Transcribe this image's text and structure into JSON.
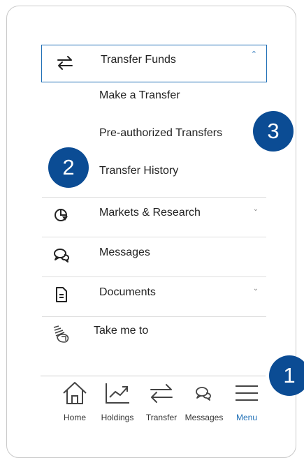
{
  "menu": {
    "header": {
      "label": "Transfer Funds",
      "icon": "transfer-arrows-icon",
      "expanded": true
    },
    "submenu": [
      "Make a Transfer",
      "Pre-authorized Transfers",
      "Transfer History"
    ],
    "items": [
      {
        "label": "Markets & Research",
        "icon": "pie-chart-icon",
        "has_chevron": true
      },
      {
        "label": "Messages",
        "icon": "chat-bubbles-icon",
        "has_chevron": false
      },
      {
        "label": "Documents",
        "icon": "document-icon",
        "has_chevron": true
      },
      {
        "label": "Take me to",
        "icon": "take-me-to-icon",
        "has_chevron": false
      }
    ]
  },
  "badges": [
    "1",
    "2",
    "3"
  ],
  "bottom_nav": {
    "tabs": [
      {
        "label": "Home",
        "icon": "home-icon"
      },
      {
        "label": "Holdings",
        "icon": "chart-line-icon"
      },
      {
        "label": "Transfer",
        "icon": "transfer-arrows-icon"
      },
      {
        "label": "Messages",
        "icon": "chat-bubbles-icon"
      },
      {
        "label": "Menu",
        "icon": "hamburger-icon",
        "active": true
      }
    ]
  },
  "colors": {
    "accent": "#1f6fb6",
    "badge": "#0b4c94",
    "text": "#222222",
    "divider": "#dedede"
  }
}
